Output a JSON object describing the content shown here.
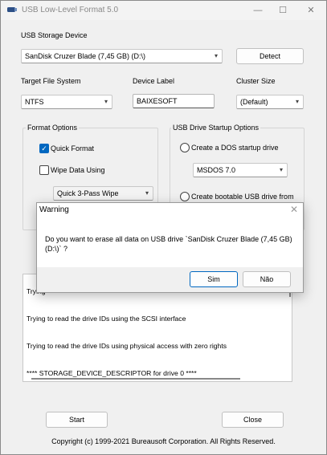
{
  "window": {
    "title": "USB Low-Level Format 5.0"
  },
  "titlebar": {
    "min": "—",
    "max": "☐",
    "close": "✕"
  },
  "device": {
    "label": "USB Storage Device",
    "selected": "SanDisk Cruzer Blade (7,45 GB) (D:\\)",
    "detect_label": "Detect"
  },
  "filesystem": {
    "label": "Target File System",
    "selected": "NTFS"
  },
  "device_label": {
    "label": "Device Label",
    "value": "BAIXESOFT"
  },
  "cluster": {
    "label": "Cluster Size",
    "selected": "(Default)"
  },
  "format_options": {
    "title": "Format Options",
    "quick_format": "Quick Format",
    "quick_format_checked": true,
    "wipe_data": "Wipe Data Using",
    "wipe_data_checked": false,
    "wipe_method": "Quick 3-Pass Wipe"
  },
  "startup_options": {
    "title": "USB Drive Startup Options",
    "dos_startup": "Create a DOS startup drive",
    "dos_version": "MSDOS 7.0",
    "bootable": "Create bootable USB drive from"
  },
  "log": {
    "lines": [
      "Trying",
      "Trying to read the drive IDs using the SCSI interface",
      "Trying to read the drive IDs using physical access with zero rights",
      "**** STORAGE_DEVICE_DESCRIPTOR for drive 0 ****"
    ]
  },
  "footer": {
    "start": "Start",
    "close": "Close",
    "copyright": "Copyright (c) 1999-2021 Bureausoft Corporation. All Rights Reserved."
  },
  "dialog": {
    "title": "Warning",
    "close": "✕",
    "message": "Do you want to erase all data on USB drive `SanDisk Cruzer Blade (7,45 GB) (D:\\)` ?",
    "yes": "Sim",
    "no": "Não"
  },
  "colors": {
    "accent": "#0067c0"
  },
  "icons": {
    "app": "usb-drive-icon",
    "dropdown": "chevron-down-icon"
  }
}
